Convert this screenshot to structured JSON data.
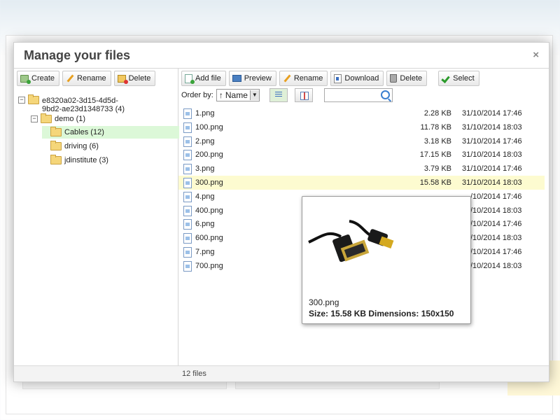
{
  "dialog": {
    "title": "Manage your files",
    "close": "×"
  },
  "left_toolbar": {
    "create": "Create",
    "rename": "Rename",
    "delete": "Delete"
  },
  "tree": {
    "root": "e8320a02-3d15-4d5d-9bd2-ae23d1348733 (4)",
    "root_line1": "e8320a02-3d15-4d5d-",
    "root_line2": "9bd2-ae23d1348733 (4)",
    "demo": "demo (1)",
    "children": [
      "Cables (12)",
      "driving (6)",
      "jdinstitute (3)"
    ],
    "selected": "Cables (12)"
  },
  "right_toolbar": {
    "add_file": "Add file",
    "preview": "Preview",
    "rename": "Rename",
    "download": "Download",
    "delete": "Delete",
    "select": "Select"
  },
  "order": {
    "label": "Order by:",
    "arrow": "↑",
    "value": "Name"
  },
  "files": [
    {
      "name": "1.png",
      "size": "2.28 KB",
      "date": "31/10/2014 17:46"
    },
    {
      "name": "100.png",
      "size": "11.78 KB",
      "date": "31/10/2014 18:03"
    },
    {
      "name": "2.png",
      "size": "3.18 KB",
      "date": "31/10/2014 17:46"
    },
    {
      "name": "200.png",
      "size": "17.15 KB",
      "date": "31/10/2014 18:03"
    },
    {
      "name": "3.png",
      "size": "3.79 KB",
      "date": "31/10/2014 17:46"
    },
    {
      "name": "300.png",
      "size": "15.58 KB",
      "date": "31/10/2014 18:03"
    },
    {
      "name": "4.png",
      "size": "",
      "date": "/10/2014 17:46"
    },
    {
      "name": "400.png",
      "size": "",
      "date": "/10/2014 18:03"
    },
    {
      "name": "6.png",
      "size": "",
      "date": "/10/2014 17:46"
    },
    {
      "name": "600.png",
      "size": "",
      "date": "/10/2014 18:03"
    },
    {
      "name": "7.png",
      "size": "",
      "date": "/10/2014 17:46"
    },
    {
      "name": "700.png",
      "size": "",
      "date": "/10/2014 18:03"
    }
  ],
  "highlighted_file": "300.png",
  "tooltip": {
    "name": "300.png",
    "meta": "Size: 15.58 KB Dimensions: 150x150"
  },
  "footer": {
    "count": "12 files"
  },
  "colors": {
    "selected_folder_bg": "#dcf8d8",
    "highlight_row_bg": "#fdfbd0"
  }
}
